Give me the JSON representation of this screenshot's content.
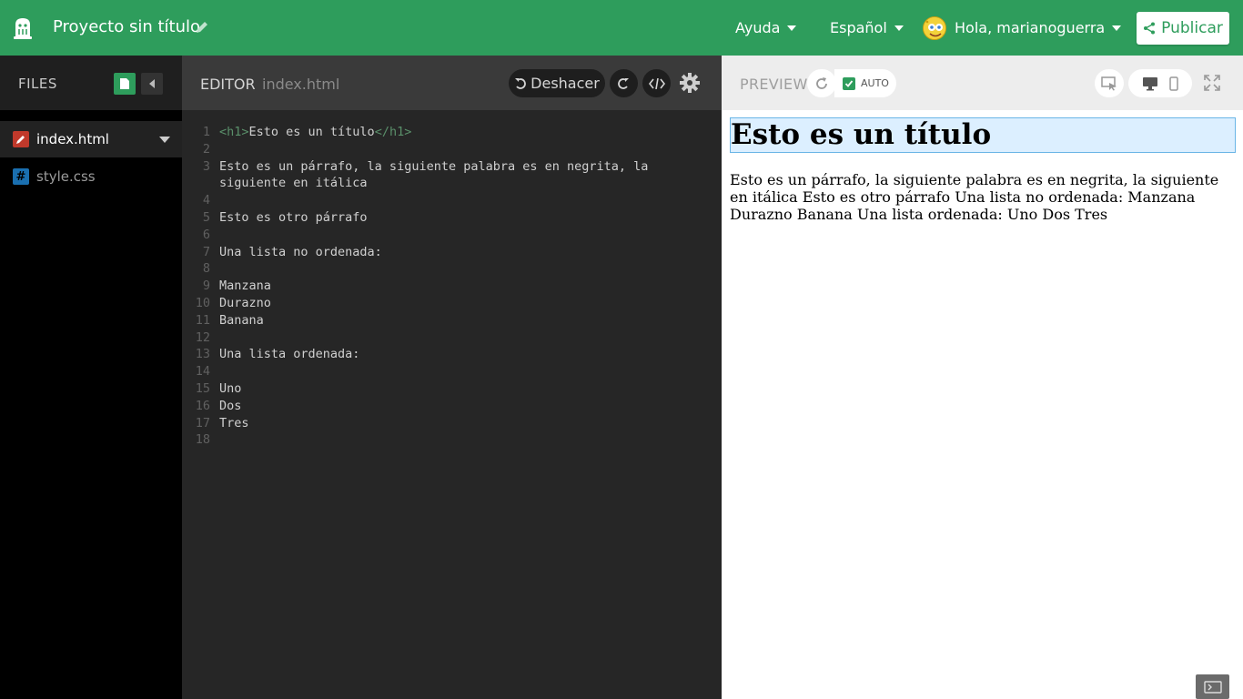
{
  "topbar": {
    "project_title": "Proyecto sin título",
    "help_label": "Ayuda",
    "language_label": "Español",
    "user_label": "Hola, marianoguerra",
    "publish_label": "Publicar",
    "accent": "#2e9d5c"
  },
  "files": {
    "title": "FILES",
    "items": [
      {
        "name": "index.html",
        "icon": "pencil-icon",
        "color": "#c0392b"
      },
      {
        "name": "style.css",
        "icon": "hash-icon",
        "color": "#1a6fb0"
      }
    ]
  },
  "editor": {
    "title": "EDITOR",
    "file": "index.html",
    "undo_label": "Deshacer",
    "lines": [
      {
        "n": "1",
        "pre": "<h1>",
        "text": "Esto es un título",
        "post": "</h1>"
      },
      {
        "n": "2",
        "text": ""
      },
      {
        "n": "3",
        "text": "Esto es un párrafo, la siguiente palabra es en negrita, la"
      },
      {
        "n": "",
        "text": "siguiente en itálica"
      },
      {
        "n": "4",
        "text": ""
      },
      {
        "n": "5",
        "text": "Esto es otro párrafo"
      },
      {
        "n": "6",
        "text": ""
      },
      {
        "n": "7",
        "text": "Una lista no ordenada:"
      },
      {
        "n": "8",
        "text": ""
      },
      {
        "n": "9",
        "text": "Manzana"
      },
      {
        "n": "10",
        "text": "Durazno"
      },
      {
        "n": "11",
        "text": "Banana"
      },
      {
        "n": "12",
        "text": ""
      },
      {
        "n": "13",
        "text": "Una lista ordenada:"
      },
      {
        "n": "14",
        "text": ""
      },
      {
        "n": "15",
        "text": "Uno"
      },
      {
        "n": "16",
        "text": "Dos"
      },
      {
        "n": "17",
        "text": "Tres"
      },
      {
        "n": "18",
        "text": ""
      }
    ]
  },
  "preview": {
    "title": "PREVIEW",
    "auto_label": "AUTO",
    "h1": "Esto es un título",
    "paragraph": "Esto es un párrafo, la siguiente palabra es en negrita, la siguiente en itálica Esto es otro párrafo Una lista no ordenada: Manzana Durazno Banana Una lista ordenada: Uno Dos Tres"
  }
}
